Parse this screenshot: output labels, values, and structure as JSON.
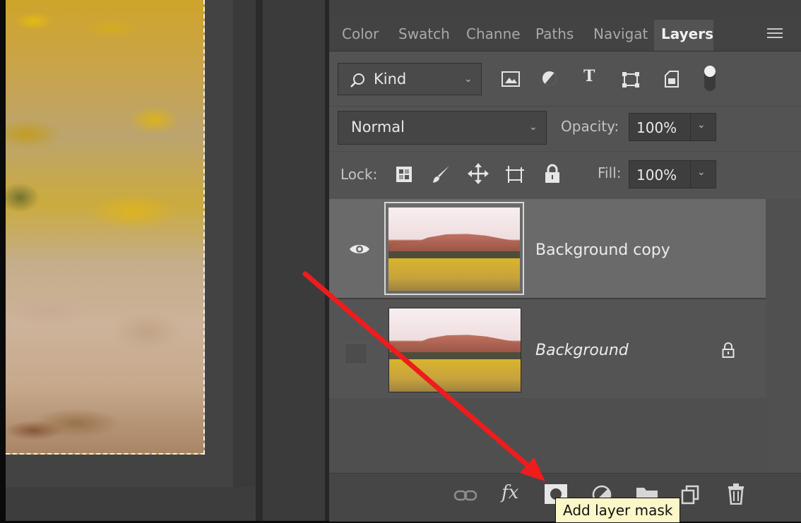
{
  "tabs": [
    {
      "label": "Color"
    },
    {
      "label": "Swatch"
    },
    {
      "label": "Channe"
    },
    {
      "label": "Paths"
    },
    {
      "label": "Navigat"
    },
    {
      "label": "Layers",
      "active": true
    }
  ],
  "filter": {
    "kind_label": "Kind",
    "icons": [
      "pixel-filter-icon",
      "adjustment-filter-icon",
      "type-filter-icon",
      "shape-filter-icon",
      "smart-object-filter-icon",
      "filter-toggle-icon"
    ]
  },
  "blend": {
    "mode": "Normal",
    "opacity_label": "Opacity:",
    "opacity_value": "100%"
  },
  "lock": {
    "label": "Lock:",
    "icons": [
      "lock-transparent-icon",
      "lock-pixels-icon",
      "lock-position-icon",
      "lock-artboard-icon",
      "lock-all-icon"
    ],
    "fill_label": "Fill:",
    "fill_value": "100%"
  },
  "layers": [
    {
      "name": "Background copy",
      "visible": true,
      "selected": true
    },
    {
      "name": "Background",
      "visible": false,
      "locked": true,
      "italic": true
    }
  ],
  "bottom_toolbar": {
    "icons": [
      "link-layers-icon",
      "fx-icon",
      "add-layer-mask-icon",
      "adjustment-layer-icon",
      "group-folder-icon",
      "new-layer-icon",
      "trash-icon"
    ],
    "fx_label": "fx",
    "tooltip": "Add layer mask"
  },
  "colors": {
    "annotation_arrow": "#ee1c1c",
    "tooltip_bg": "#fbf7c8",
    "selected_layer_bg": "#6a6a6a"
  }
}
